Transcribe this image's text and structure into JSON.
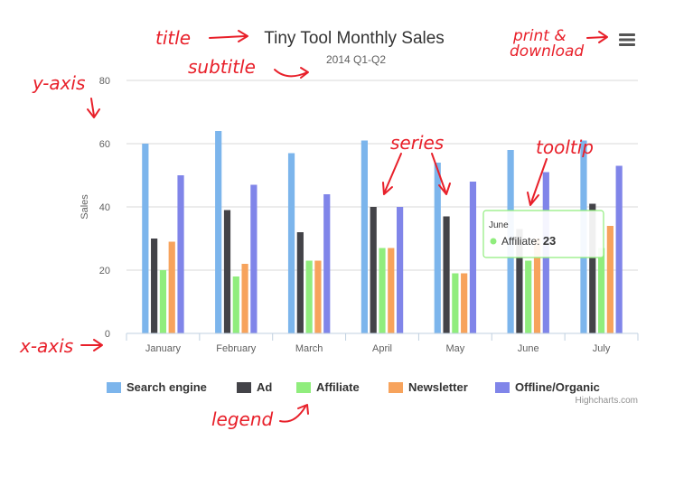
{
  "chart_data": {
    "type": "bar",
    "title": "Tiny Tool Monthly Sales",
    "subtitle": "2014 Q1-Q2",
    "xlabel": "",
    "ylabel": "Sales",
    "ylim": [
      0,
      80
    ],
    "yticks": [
      0,
      20,
      40,
      60,
      80
    ],
    "grid": true,
    "legend_position": "bottom",
    "categories": [
      "January",
      "February",
      "March",
      "April",
      "May",
      "June",
      "July"
    ],
    "series": [
      {
        "name": "Search engine",
        "color": "#7cb5ec",
        "values": [
          60,
          64,
          57,
          61,
          54,
          58,
          61
        ]
      },
      {
        "name": "Ad",
        "color": "#434348",
        "values": [
          30,
          39,
          32,
          40,
          37,
          33,
          41
        ]
      },
      {
        "name": "Affiliate",
        "color": "#90ed7d",
        "values": [
          20,
          18,
          23,
          27,
          19,
          23,
          27
        ]
      },
      {
        "name": "Newsletter",
        "color": "#f7a35c",
        "values": [
          29,
          22,
          23,
          27,
          19,
          30,
          34
        ]
      },
      {
        "name": "Offline/Organic",
        "color": "#8085e9",
        "values": [
          50,
          47,
          44,
          40,
          48,
          51,
          53
        ]
      }
    ],
    "tooltip": {
      "category": "June",
      "series": "Affiliate",
      "label": "Affiliate: ",
      "value": "23",
      "marker_color": "#90ed7d"
    },
    "credits": "Highcharts.com"
  },
  "annotations": {
    "title": "title",
    "subtitle": "subtitle",
    "y_axis": "y-axis",
    "x_axis": "x-axis",
    "series": "series",
    "tooltip": "tooltip",
    "legend": "legend",
    "print_line1": "print &",
    "print_line2": "download"
  },
  "colors": {
    "annotation": "#e8202a",
    "grid": "#d8d8d8",
    "axis": "#c0d0e0",
    "text": "#606060",
    "title": "#333333"
  },
  "icons": {
    "menu": "hamburger-menu-icon"
  }
}
